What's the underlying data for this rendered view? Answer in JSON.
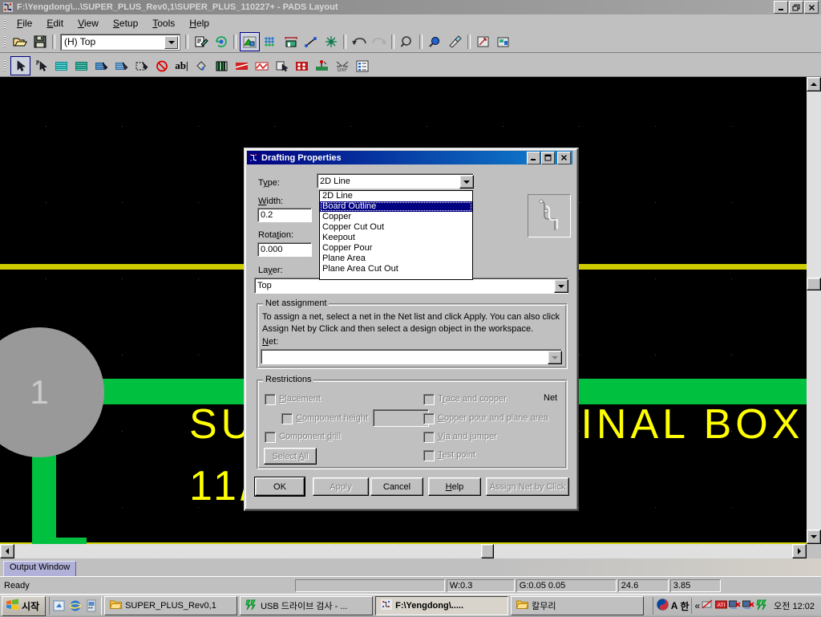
{
  "window": {
    "title": "F:\\Yengdong\\...\\SUPER_PLUS_Rev0,1\\SUPER_PLUS_110227+ - PADS Layout",
    "icon": "pads-layout-icon",
    "minimize": "_",
    "restore": "❐",
    "close": "✕"
  },
  "menu": {
    "items": [
      {
        "label": "File",
        "accel": "F"
      },
      {
        "label": "Edit",
        "accel": "E"
      },
      {
        "label": "View",
        "accel": "V"
      },
      {
        "label": "Setup",
        "accel": "S"
      },
      {
        "label": "Tools",
        "accel": "T"
      },
      {
        "label": "Help",
        "accel": "H"
      }
    ]
  },
  "toolbar_main": {
    "layer_combo_value": "(H) Top",
    "buttons": [
      {
        "name": "open-icon"
      },
      {
        "name": "save-icon"
      },
      {
        "name": "design-rules-icon"
      },
      {
        "name": "pour-manager-icon"
      },
      {
        "name": "design-toolbar-icon"
      },
      {
        "name": "ecо-toolbar-icon"
      },
      {
        "name": "dimensioning-icon"
      },
      {
        "name": "drafting-icon"
      },
      {
        "name": "route-icon"
      },
      {
        "name": "undo-icon"
      },
      {
        "name": "redo-icon"
      },
      {
        "name": "find-icon"
      },
      {
        "name": "zoom-icon"
      },
      {
        "name": "redraw-icon"
      },
      {
        "name": "pan-icon"
      },
      {
        "name": "view-board-icon"
      }
    ]
  },
  "toolbar_drafting": {
    "buttons": [
      {
        "name": "select-arrow-icon"
      },
      {
        "name": "select-alternate-icon"
      },
      {
        "name": "board-outline-icon"
      },
      {
        "name": "copper-icon"
      },
      {
        "name": "copper-pour-icon"
      },
      {
        "name": "plane-area-icon"
      },
      {
        "name": "cut-out-icon"
      },
      {
        "name": "keepout-icon"
      },
      {
        "name": "text-icon",
        "label": "ab|"
      },
      {
        "name": "fill-icon"
      },
      {
        "name": "library-icon"
      },
      {
        "name": "copper-plane-icon"
      },
      {
        "name": "path-icon"
      },
      {
        "name": "copy-icon"
      },
      {
        "name": "drill-icon"
      },
      {
        "name": "test-point-icon"
      },
      {
        "name": "dxf-icon"
      },
      {
        "name": "properties-icon"
      }
    ]
  },
  "canvas": {
    "background_color": "#000000",
    "board_outline_color": "#cccc00",
    "trace_color": "#00c040",
    "pad_color": "#999999",
    "silk_color": "#ffff00",
    "pad_label": "1",
    "silk_line1": "SU",
    "silk_line1b": "IINAL BOX",
    "silk_line2": "11/"
  },
  "dialog": {
    "title": "Drafting Properties",
    "icon": "drafting-properties-icon",
    "minimize": "_",
    "maximize": "❐",
    "close": "✕",
    "type_label": "Type:",
    "type_value": "2D Line",
    "type_options": [
      "2D Line",
      "Board Outline",
      "Copper",
      "Copper Cut Out",
      "Keepout",
      "Copper Pour",
      "Plane Area",
      "Plane Area Cut Out"
    ],
    "type_selected_index": 1,
    "width_label": "Width:",
    "width_value": "0.2",
    "rotation_label": "Rotation:",
    "rotation_value": "0.000",
    "layer_label": "Layer:",
    "layer_value": "Top",
    "net_preview_label": "Net",
    "net_group": {
      "legend": "Net assignment",
      "help_line1": "To assign a net, select a net in the Net list and click Apply. You can also click",
      "help_line2": "Assign Net by Click and then select a design object in the workspace.",
      "net_label": "Net:",
      "net_value": ""
    },
    "restrictions": {
      "legend": "Restrictions",
      "left": [
        {
          "label": "Placement",
          "accel": "P",
          "checked": false,
          "enabled": false
        },
        {
          "label": "Component height",
          "accel": "C",
          "checked": false,
          "enabled": false
        },
        {
          "label": "Component drill",
          "accel": "d",
          "checked": false,
          "enabled": false
        }
      ],
      "height_value": "",
      "select_all_label": "Select All",
      "right": [
        {
          "label": "Trace and copper",
          "accel": "r",
          "checked": false,
          "enabled": false
        },
        {
          "label": "Copper pour and plane area",
          "accel": "C",
          "checked": false,
          "enabled": false
        },
        {
          "label": "Via and jumper",
          "accel": "V",
          "checked": false,
          "enabled": false
        },
        {
          "label": "Test point",
          "accel": "T",
          "checked": false,
          "enabled": false
        }
      ]
    },
    "buttons": [
      {
        "label": "OK",
        "enabled": true,
        "default": true
      },
      {
        "label": "Apply",
        "enabled": false
      },
      {
        "label": "Cancel",
        "enabled": true
      },
      {
        "label": "Help",
        "enabled": true,
        "accel": "H"
      },
      {
        "label": "Assign Net by Click",
        "enabled": false
      }
    ]
  },
  "output_window": {
    "tab_label": "Output Window"
  },
  "statusbar": {
    "ready": "Ready",
    "blank_panel": "",
    "width": "W:0.3",
    "grid": "G:0.05 0.05",
    "x_coord": "24.6",
    "y_coord": "3.85"
  },
  "taskbar": {
    "start_label": "시작",
    "quick_launch": [
      {
        "name": "show-desktop-icon"
      },
      {
        "name": "internet-explorer-icon"
      },
      {
        "name": "media-player-icon"
      }
    ],
    "tasks": [
      {
        "label": "SUPER_PLUS_Rev0,1",
        "icon": "folder-icon",
        "active": false
      },
      {
        "label": "USB 드라이브 검사 - ...",
        "icon": "antivirus-icon",
        "active": false
      },
      {
        "label": "F:\\Yengdong\\.....",
        "icon": "pads-layout-icon",
        "active": true
      },
      {
        "label": "칼무리",
        "icon": "folder-icon",
        "active": false
      }
    ],
    "tray": {
      "ime_lang": "A",
      "ime_mode": "한",
      "chevron": "«",
      "icons": [
        {
          "name": "network-disconnected-icon"
        },
        {
          "name": "ati-display-icon"
        },
        {
          "name": "volume-muted-icon"
        },
        {
          "name": "network-status-icon"
        },
        {
          "name": "antivirus-tray-icon"
        }
      ],
      "clock": "오전 12:02"
    }
  }
}
